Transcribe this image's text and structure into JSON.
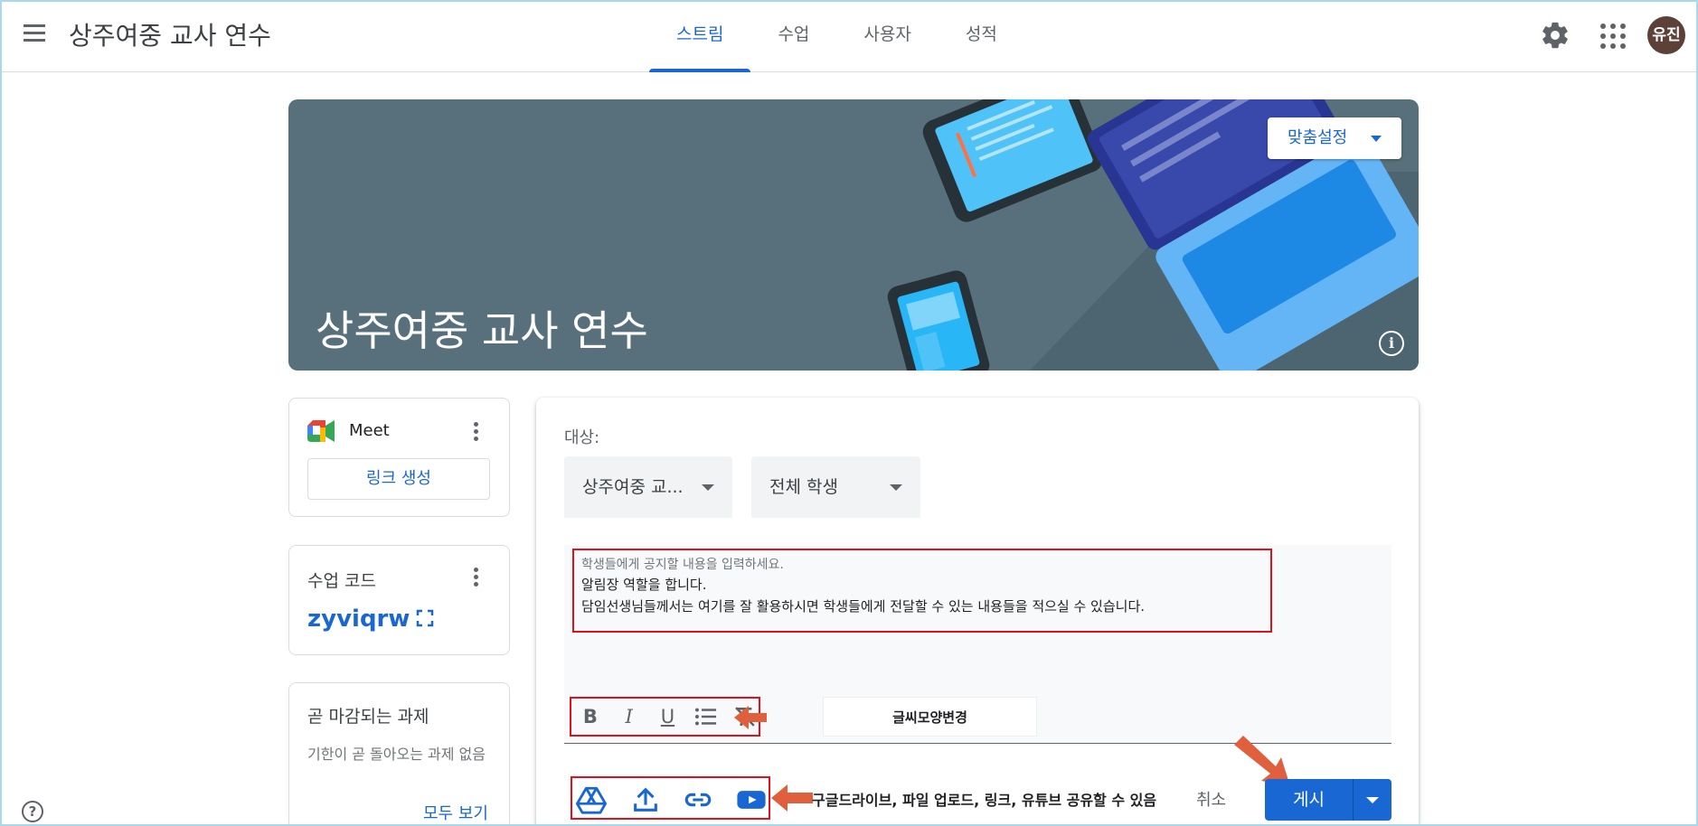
{
  "header": {
    "class_title": "상주여중 교사 연수",
    "tabs": [
      {
        "label": "스트림",
        "active": true
      },
      {
        "label": "수업",
        "active": false
      },
      {
        "label": "사용자",
        "active": false
      },
      {
        "label": "성적",
        "active": false
      }
    ],
    "avatar_initials": "유진",
    "avatar_color": "#5d4037"
  },
  "banner": {
    "title": "상주여중 교사 연수",
    "customize_label": "맞춤설정",
    "info_symbol": "i",
    "color": "#57707b"
  },
  "meet": {
    "label": "Meet",
    "link_button": "링크 생성"
  },
  "class_code": {
    "label": "수업 코드",
    "value": "zyviqrw"
  },
  "upcoming": {
    "title": "곧 마감되는 과제",
    "empty_text": "기한이 곧 돌아오는 과제 없음",
    "view_all": "모두 보기"
  },
  "help_symbol": "?",
  "composer": {
    "target_label": "대상:",
    "class_select": "상주여중 교...",
    "students_select": "전체 학생",
    "placeholder": "학생들에게 공지할 내용을 입력하세요.",
    "lines": [
      "알림장 역할을 합니다.",
      "담임선생님들께서는 여기를 잘 활용하시면 학생들에게 전달할 수 있는 내용들을 적으실 수 있습니다."
    ],
    "format_buttons": {
      "bold": "B",
      "italic": "I",
      "underline": "U"
    },
    "format_note": "글씨모양변경",
    "attach_note": "구글드라이브, 파일 업로드, 링크, 유튜브 공유할 수 있음",
    "cancel_label": "취소",
    "post_label": "게시"
  },
  "colors": {
    "accent": "#1967d2",
    "annotation_box": "#e0101c",
    "annotation_arrow": "#e0603e"
  },
  "icons": [
    "menu-icon",
    "gear-icon",
    "apps-grid-icon",
    "info-icon",
    "meet-logo-icon",
    "more-vert-icon",
    "fullscreen-icon",
    "help-icon",
    "bulleted-list-icon",
    "clear-format-icon",
    "google-drive-icon",
    "upload-icon",
    "link-icon",
    "youtube-icon",
    "arrow-left-icon",
    "arrow-down-right-icon",
    "chevron-down-icon"
  ]
}
